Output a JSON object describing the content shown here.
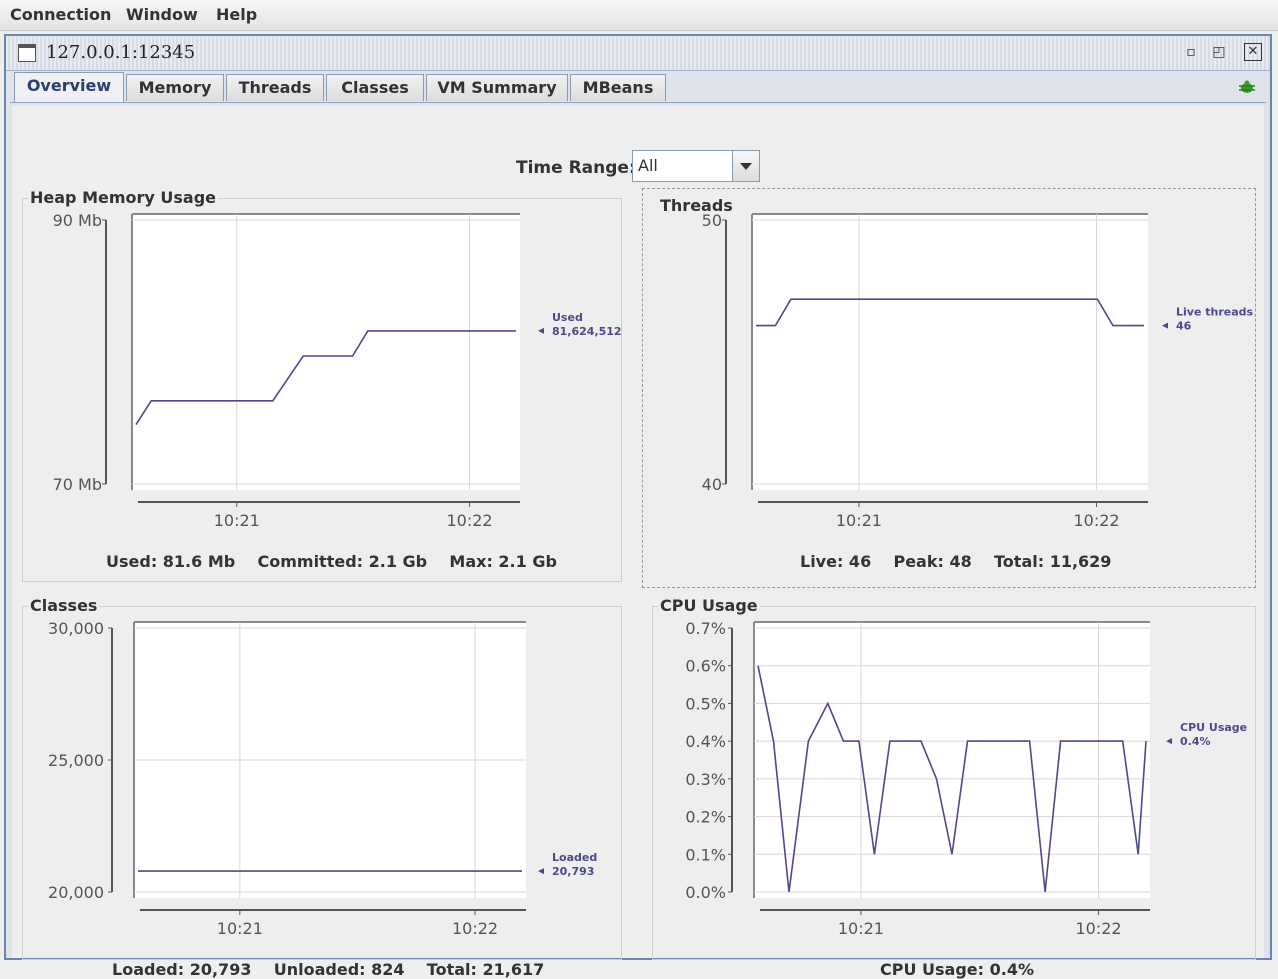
{
  "menu": [
    "Connection",
    "Window",
    "Help"
  ],
  "window": {
    "title": "127.0.0.1:12345"
  },
  "tabs": [
    "Overview",
    "Memory",
    "Threads",
    "Classes",
    "VM Summary",
    "MBeans"
  ],
  "active_tab": "Overview",
  "time_range": {
    "label": "Time Range:",
    "value": "All"
  },
  "panels": {
    "heap": {
      "title": "Heap Memory Usage",
      "footer": "Used: 81.6 Mb    Committed: 2.1 Gb    Max: 2.1 Gb",
      "legend_name": "Used",
      "legend_value": "81,624,512"
    },
    "threads": {
      "title": "Threads",
      "footer": "Live: 46    Peak: 48    Total: 11,629",
      "legend_name": "Live threads",
      "legend_value": "46"
    },
    "classes": {
      "title": "Classes",
      "footer": "Loaded: 20,793    Unloaded: 824    Total: 21,617",
      "legend_name": "Loaded",
      "legend_value": "20,793"
    },
    "cpu": {
      "title": "CPU Usage",
      "footer": "CPU Usage: 0.4%",
      "legend_name": "CPU Usage",
      "legend_value": "0.4%"
    }
  },
  "colors": {
    "line": "#4a4a8c",
    "grid": "#d8d8d8",
    "axis": "#555555"
  },
  "chart_data": [
    {
      "id": "heap",
      "type": "line",
      "title": "Heap Memory Usage",
      "ylim": [
        70,
        90
      ],
      "yticks": [
        "90 Mb",
        "70 Mb"
      ],
      "ytick_values": [
        90,
        70
      ],
      "xticks": [
        "10:21",
        "10:22"
      ],
      "xtick_values": [
        0.27,
        0.87
      ],
      "x": [
        0.0,
        0.04,
        0.36,
        0.44,
        0.57,
        0.61,
        1.0
      ],
      "series": [
        {
          "name": "Used",
          "values": [
            74.5,
            76.3,
            76.3,
            79.7,
            79.7,
            81.6,
            81.6
          ]
        }
      ]
    },
    {
      "id": "threads",
      "type": "line",
      "title": "Threads",
      "ylim": [
        40,
        50
      ],
      "yticks": [
        "50",
        "40"
      ],
      "ytick_values": [
        50,
        40
      ],
      "xticks": [
        "10:21",
        "10:22"
      ],
      "xtick_values": [
        0.27,
        0.87
      ],
      "x": [
        0.0,
        0.05,
        0.09,
        0.88,
        0.92,
        1.0
      ],
      "series": [
        {
          "name": "Live threads",
          "values": [
            46,
            46,
            47,
            47,
            46,
            46
          ]
        }
      ]
    },
    {
      "id": "classes",
      "type": "line",
      "title": "Classes",
      "ylim": [
        20000,
        30000
      ],
      "yticks": [
        "30,000",
        "25,000",
        "20,000"
      ],
      "ytick_values": [
        30000,
        25000,
        20000
      ],
      "xticks": [
        "10:21",
        "10:22"
      ],
      "xtick_values": [
        0.27,
        0.87
      ],
      "x": [
        0.0,
        1.0
      ],
      "series": [
        {
          "name": "Loaded",
          "values": [
            20793,
            20793
          ]
        }
      ]
    },
    {
      "id": "cpu",
      "type": "line",
      "title": "CPU Usage",
      "ylim": [
        0,
        0.7
      ],
      "yticks": [
        "0.7%",
        "0.6%",
        "0.5%",
        "0.4%",
        "0.3%",
        "0.2%",
        "0.1%",
        "0.0%"
      ],
      "ytick_values": [
        0.7,
        0.6,
        0.5,
        0.4,
        0.3,
        0.2,
        0.1,
        0.0
      ],
      "xticks": [
        "10:21",
        "10:22"
      ],
      "xtick_values": [
        0.27,
        0.87
      ],
      "x": [
        0.0,
        0.04,
        0.08,
        0.13,
        0.18,
        0.22,
        0.26,
        0.3,
        0.34,
        0.38,
        0.42,
        0.46,
        0.5,
        0.54,
        0.58,
        0.62,
        0.66,
        0.7,
        0.74,
        0.78,
        0.82,
        0.86,
        0.9,
        0.94,
        0.98,
        1.0
      ],
      "series": [
        {
          "name": "CPU Usage",
          "values": [
            0.6,
            0.4,
            0.0,
            0.4,
            0.5,
            0.4,
            0.4,
            0.1,
            0.4,
            0.4,
            0.4,
            0.3,
            0.1,
            0.4,
            0.4,
            0.4,
            0.4,
            0.4,
            0.0,
            0.4,
            0.4,
            0.4,
            0.4,
            0.4,
            0.1,
            0.4
          ]
        }
      ]
    }
  ]
}
